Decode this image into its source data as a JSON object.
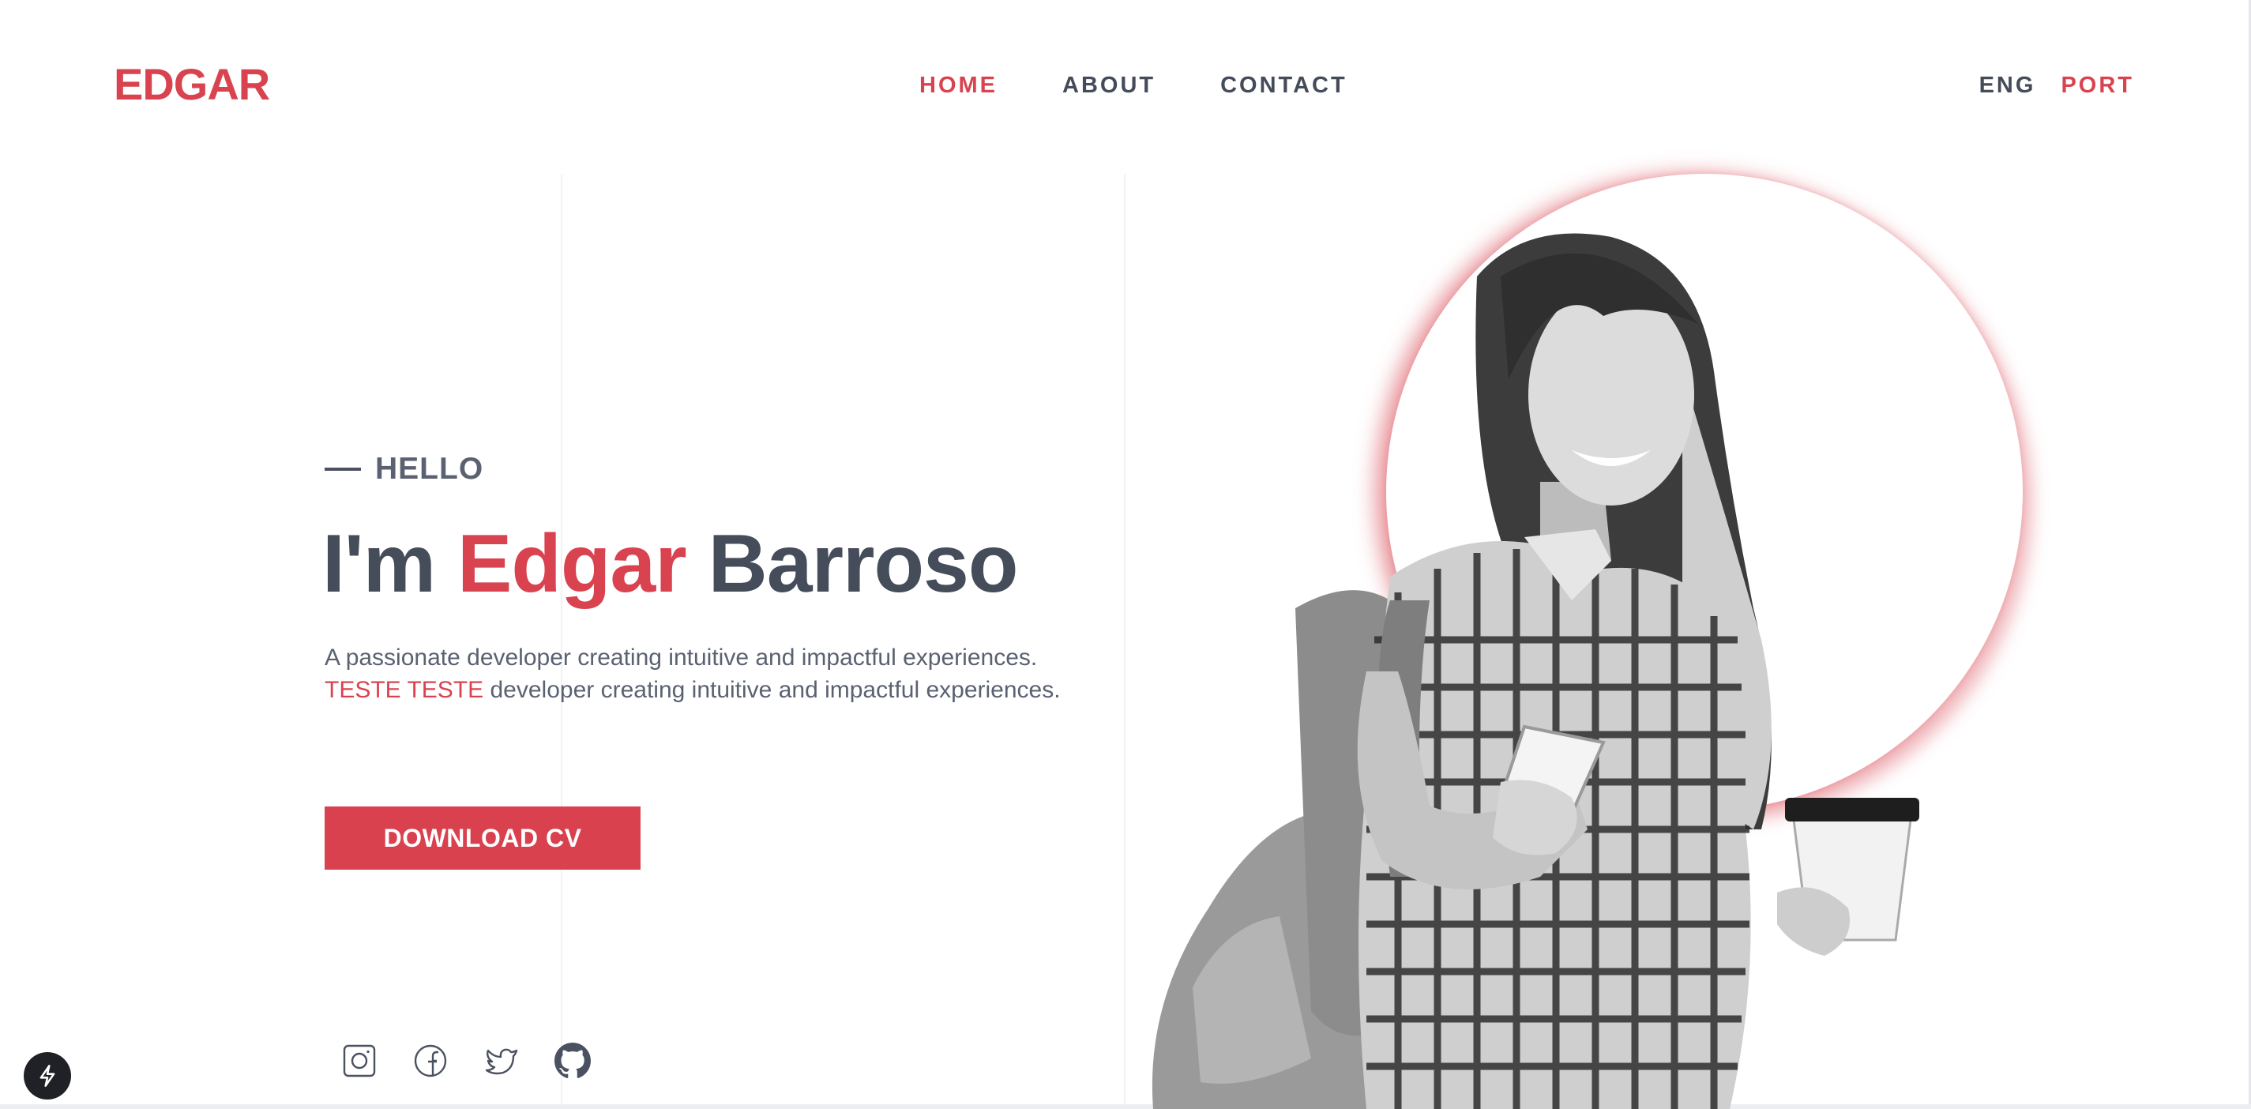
{
  "header": {
    "logo": "EDGAR",
    "nav": [
      {
        "label": "HOME",
        "active": true
      },
      {
        "label": "ABOUT",
        "active": false
      },
      {
        "label": "CONTACT",
        "active": false
      }
    ],
    "languages": [
      {
        "label": "ENG",
        "active": false
      },
      {
        "label": "PORT",
        "active": true
      }
    ]
  },
  "hero": {
    "greeting": "HELLO",
    "headline": {
      "prefix": "I'm ",
      "first_name": "Edgar",
      "last_name": " Barroso"
    },
    "description_line1": "A passionate developer creating intuitive and impactful experiences.",
    "description_line2_accent": "TESTE TESTE",
    "description_line2_rest": " developer creating intuitive and impactful experiences.",
    "cta_label": "DOWNLOAD CV"
  },
  "socials": [
    {
      "icon": "instagram-icon"
    },
    {
      "icon": "facebook-icon"
    },
    {
      "icon": "twitter-icon"
    },
    {
      "icon": "github-icon"
    }
  ],
  "colors": {
    "accent": "#d9434f",
    "text": "#454c5a",
    "background": "#ffffff"
  }
}
